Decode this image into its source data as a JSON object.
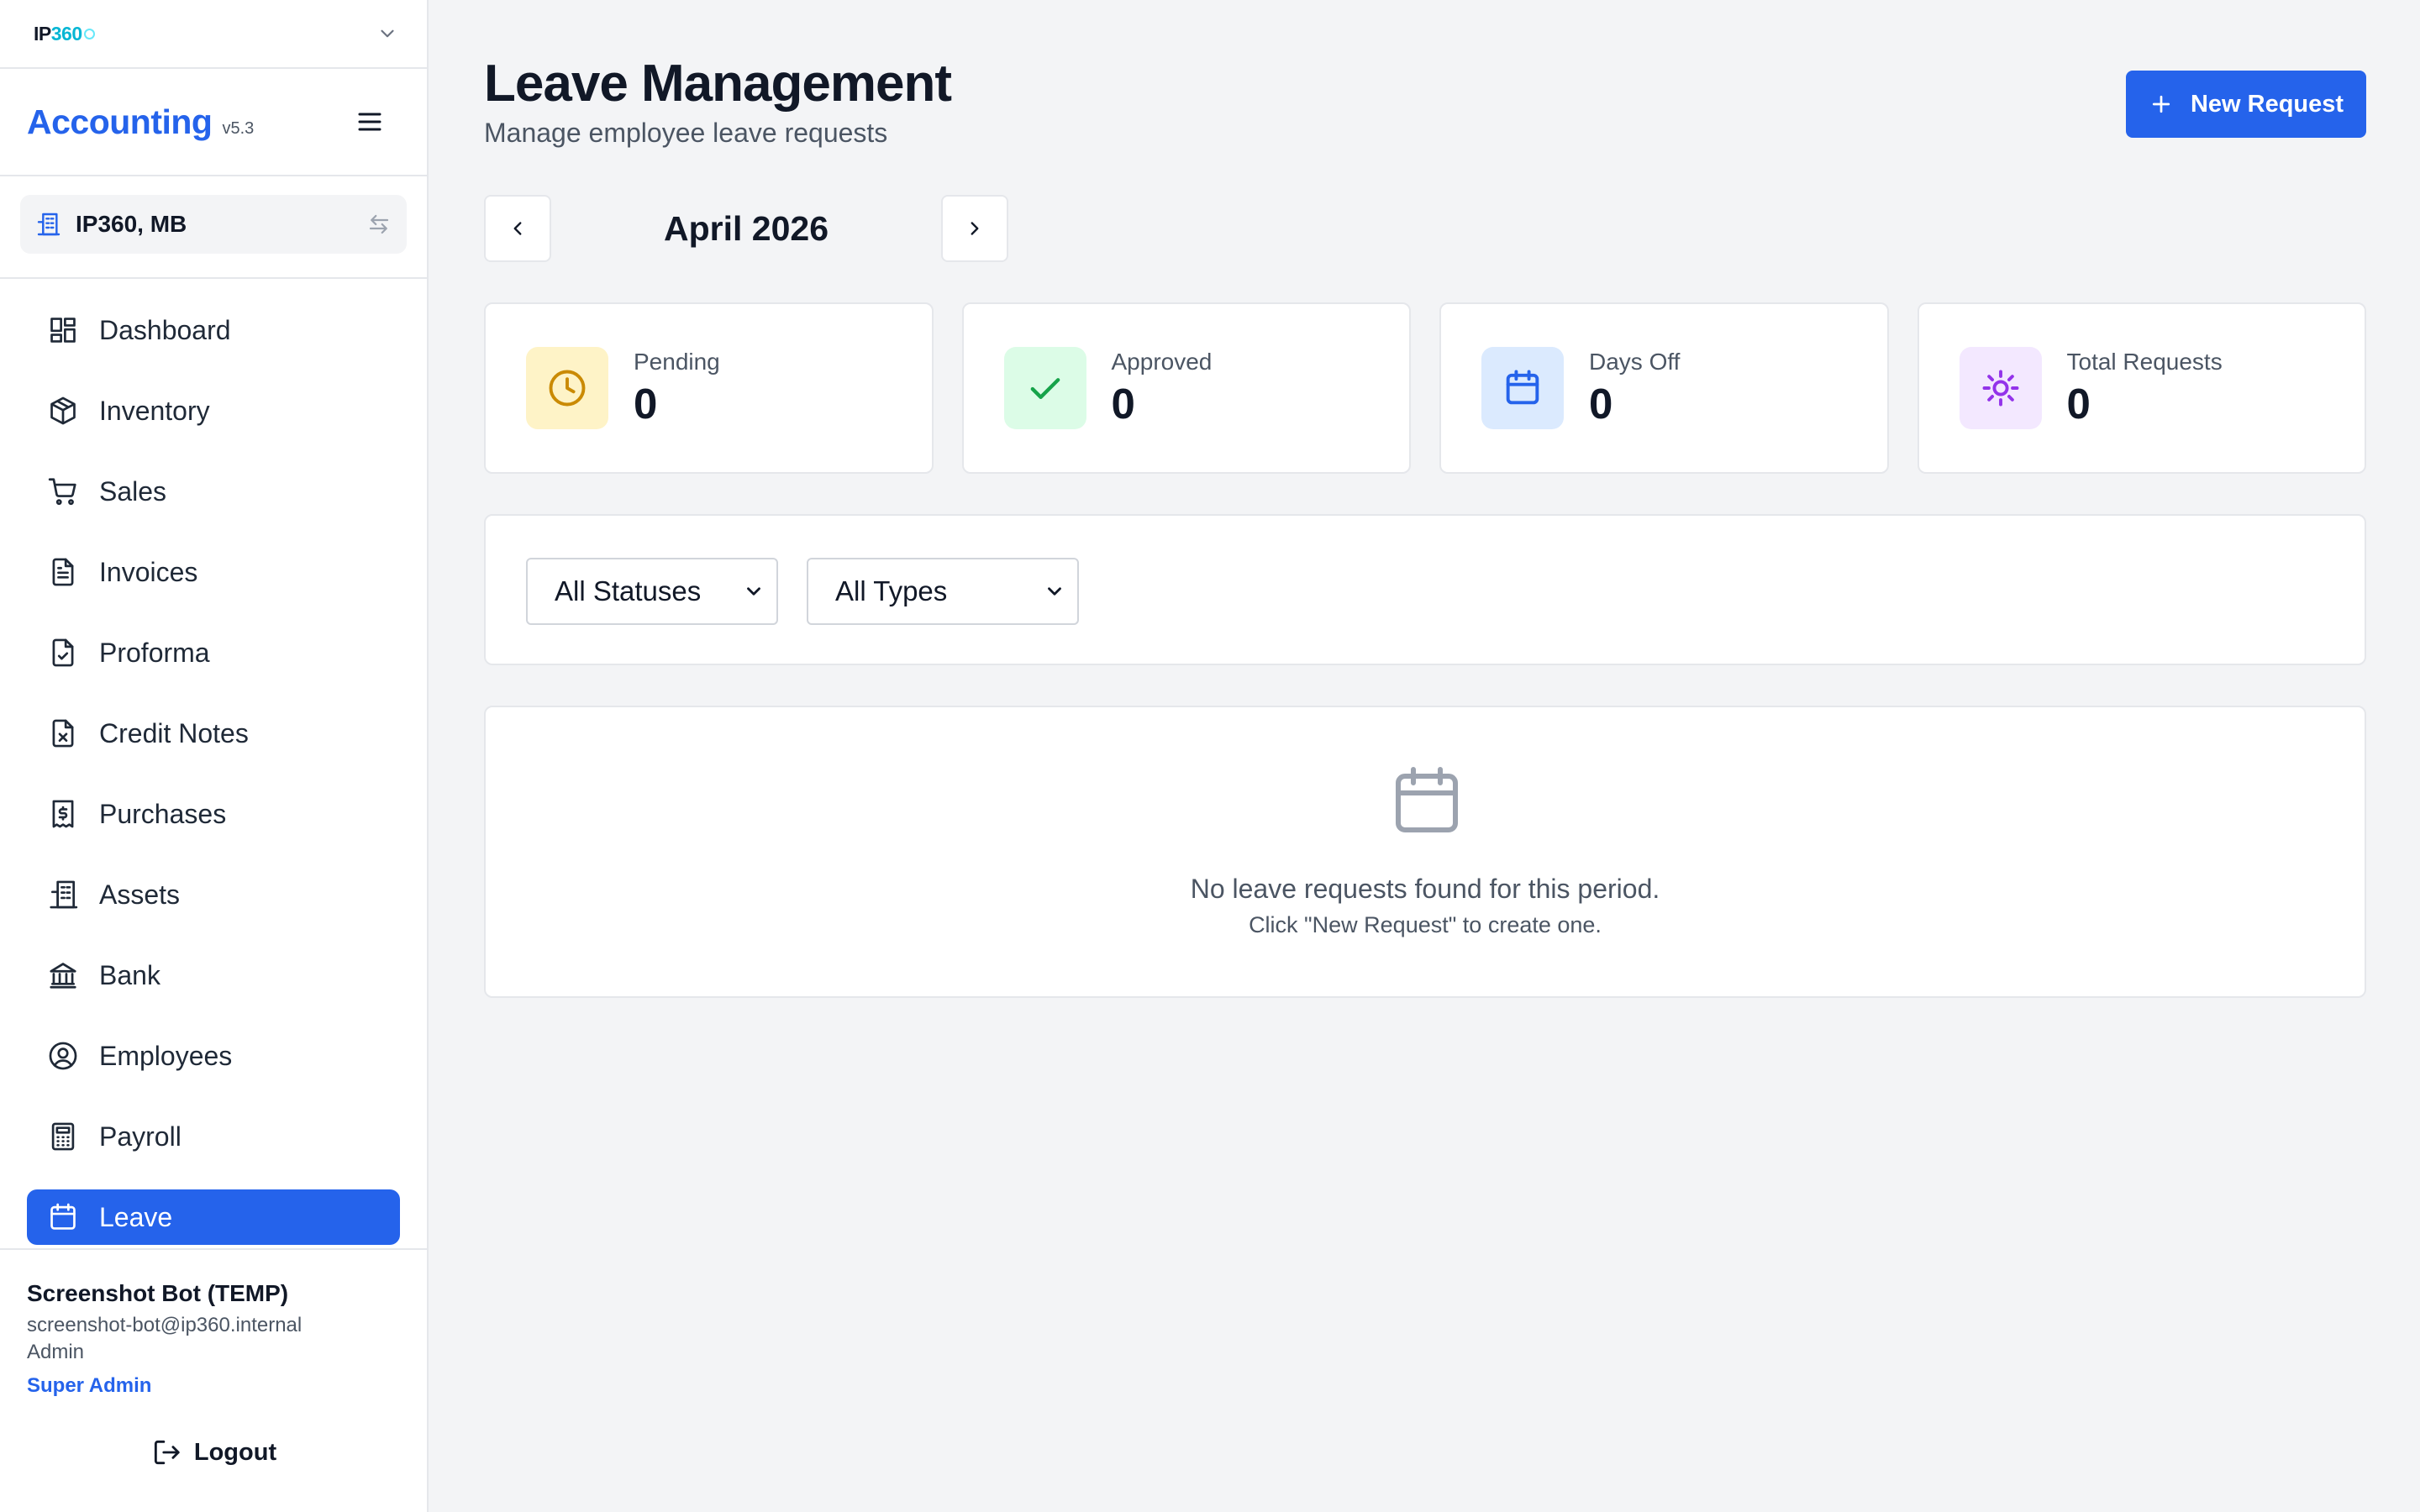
{
  "org": {
    "logo_main": "IP",
    "logo_accent": "360"
  },
  "app": {
    "name": "Accounting",
    "version": "v5.3"
  },
  "company": {
    "name": "IP360, MB"
  },
  "nav": [
    {
      "label": "Dashboard",
      "icon": "dashboard-icon"
    },
    {
      "label": "Inventory",
      "icon": "box-icon"
    },
    {
      "label": "Sales",
      "icon": "cart-icon"
    },
    {
      "label": "Invoices",
      "icon": "document-icon"
    },
    {
      "label": "Proforma",
      "icon": "document-check-icon"
    },
    {
      "label": "Credit Notes",
      "icon": "document-x-icon"
    },
    {
      "label": "Purchases",
      "icon": "receipt-dollar-icon"
    },
    {
      "label": "Assets",
      "icon": "building-icon"
    },
    {
      "label": "Bank",
      "icon": "bank-icon"
    },
    {
      "label": "Employees",
      "icon": "user-circle-icon"
    },
    {
      "label": "Payroll",
      "icon": "calculator-icon"
    },
    {
      "label": "Leave",
      "icon": "calendar-icon",
      "active": true
    }
  ],
  "user": {
    "name": "Screenshot Bot (TEMP)",
    "email": "screenshot-bot@ip360.internal",
    "role": "Admin",
    "super_role": "Super Admin",
    "logout_label": "Logout"
  },
  "header": {
    "title": "Leave Management",
    "subtitle": "Manage employee leave requests",
    "new_button_label": "New Request"
  },
  "period": {
    "label": "April 2026"
  },
  "stats": [
    {
      "label": "Pending",
      "value": "0",
      "icon": "clock-icon",
      "bg": "#fef3c7",
      "color": "#ca8a04"
    },
    {
      "label": "Approved",
      "value": "0",
      "icon": "check-icon",
      "bg": "#dcfce7",
      "color": "#16a34a"
    },
    {
      "label": "Days Off",
      "value": "0",
      "icon": "calendar-icon",
      "bg": "#dbeafe",
      "color": "#2563eb"
    },
    {
      "label": "Total Requests",
      "value": "0",
      "icon": "sun-icon",
      "bg": "#f3e8ff",
      "color": "#9333ea"
    }
  ],
  "filters": {
    "status_selected": "All Statuses",
    "type_selected": "All Types"
  },
  "empty_state": {
    "title": "No leave requests found for this period.",
    "hint": "Click \"New Request\" to create one."
  },
  "colors": {
    "primary": "#2563eb",
    "accent": "#06b6d4"
  }
}
